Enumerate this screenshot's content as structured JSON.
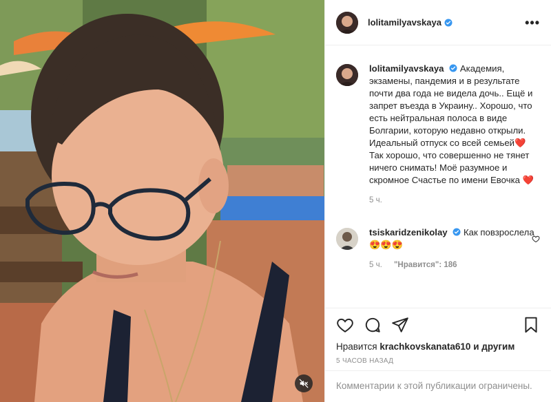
{
  "post": {
    "author": "lolitamilyavskaya",
    "more_label": "•••",
    "media": {
      "muted": true,
      "mute_icon": "speaker-muted-icon"
    }
  },
  "caption": {
    "author": "lolitamilyavskaya",
    "text": "Академия, экзамены, пандемия и в результате почти два года не видела дочь.. Ещё и запрет въезда в Украину.. Хорошо, что есть нейтральная полоса в виде Болгарии, которую недавно открыли. Идеальный отпуск со всей семьей",
    "text2": " Так хорошо, что совершенно не тянет ничего снимать! Моё разумное и скромное Счастье по имени Евочка",
    "heart": "❤️",
    "time": "5 ч."
  },
  "comment": {
    "author": "tsiskaridzenikolay",
    "text": "Как повзрослела ",
    "emoji": "😍😍😍",
    "time": "5 ч.",
    "likes": "\"Нравится\": 186"
  },
  "actions": {
    "likes_prefix": "Нравится",
    "likes_user": "krachkovskanata610",
    "likes_suffix": "и другим",
    "time_ago": "5 часов назад",
    "comments_closed": "Комментарии к этой публикации ограничены."
  },
  "colors": {
    "verified": "#3897f0",
    "heart": "#ed1c24",
    "muted_text": "#8e8e8e"
  }
}
